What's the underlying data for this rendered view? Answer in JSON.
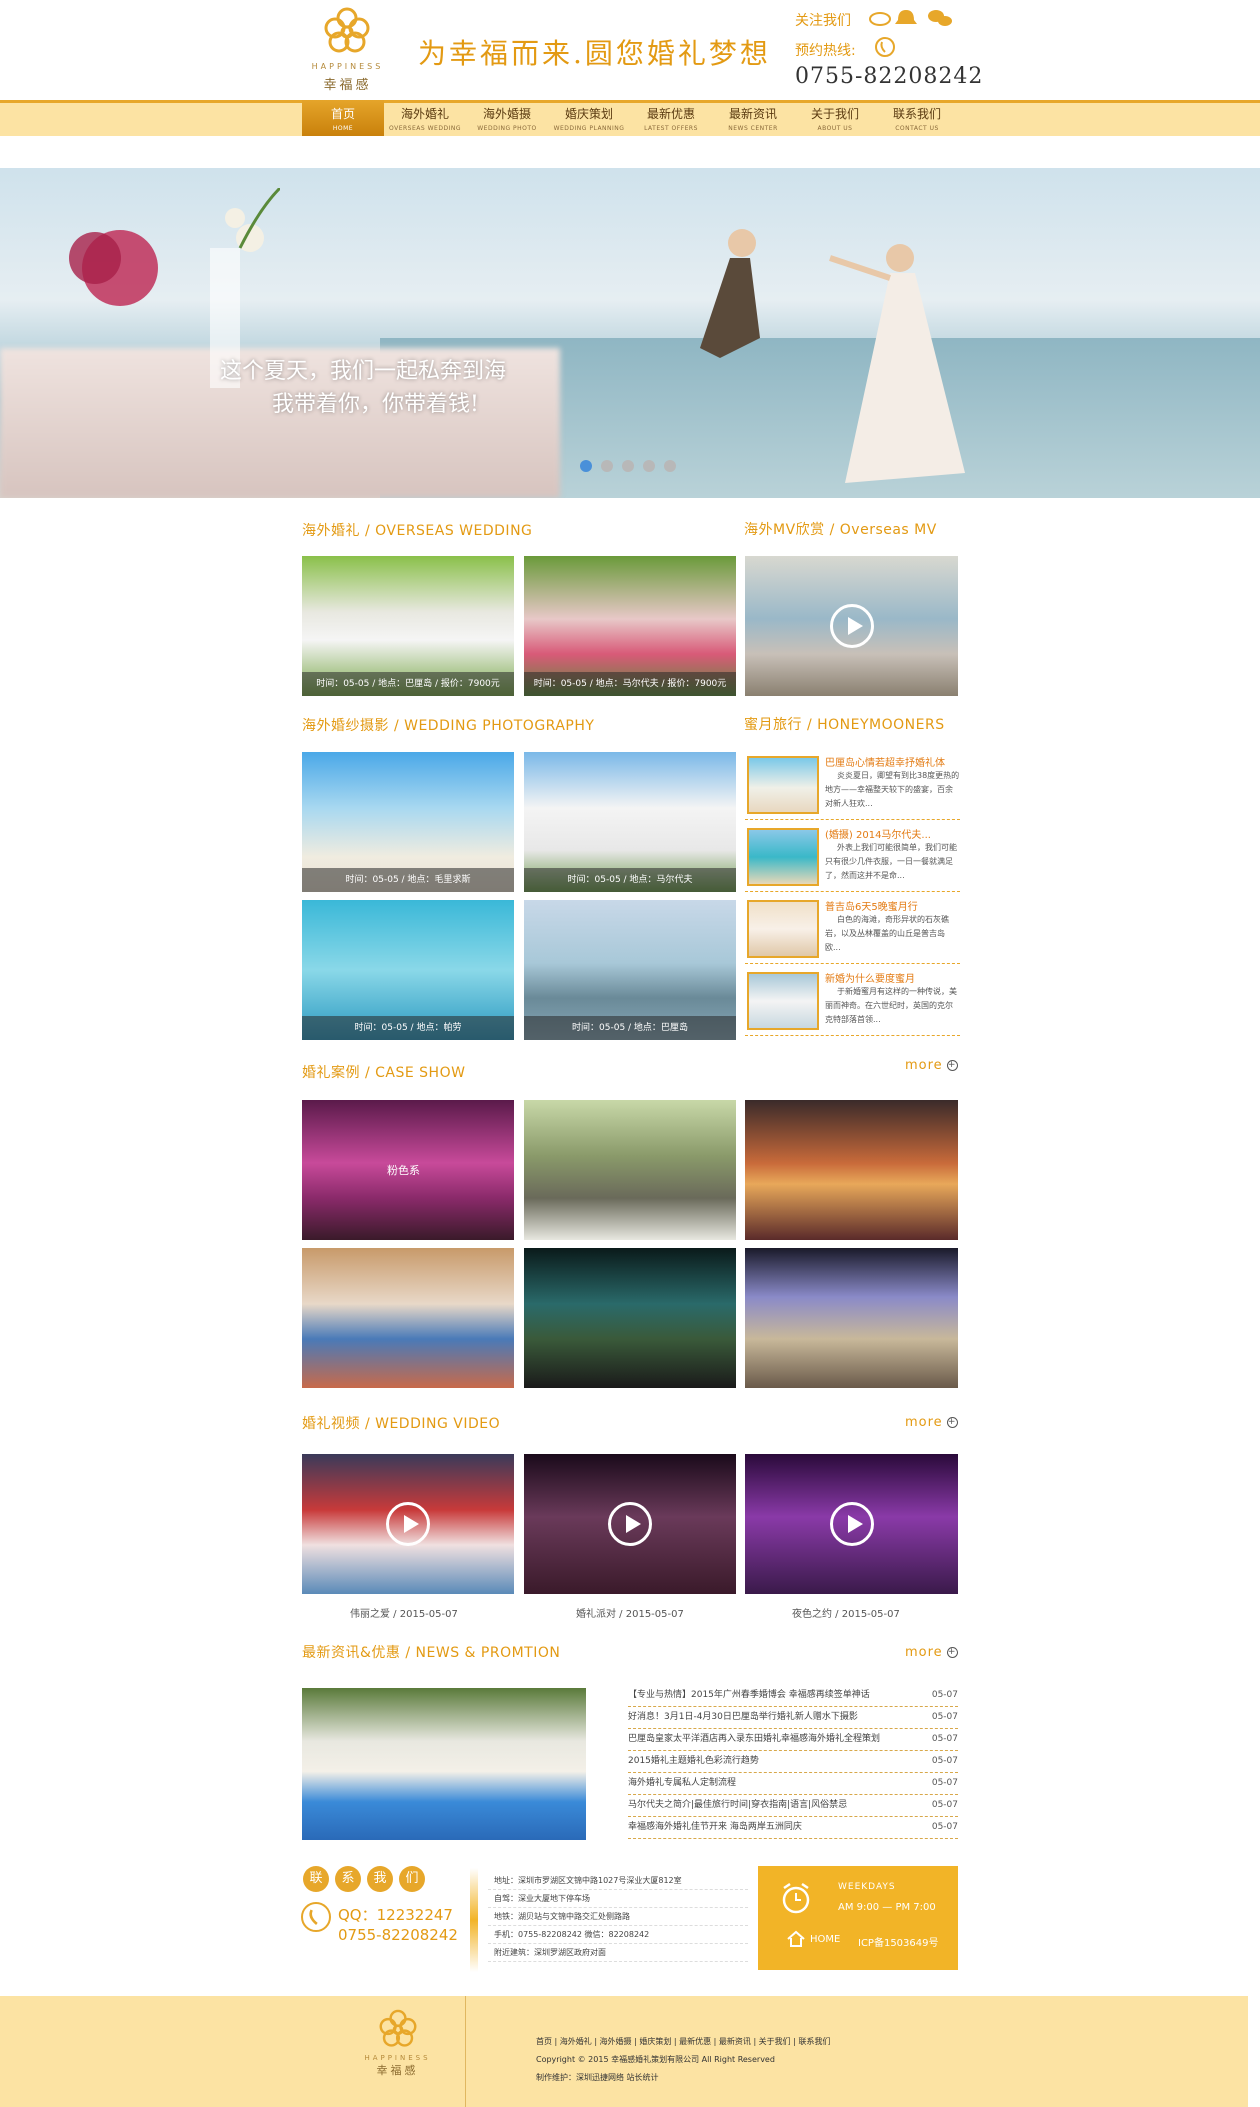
{
  "header": {
    "logo_en": "HAPPINESS",
    "logo_cn": "幸福感",
    "slogan": "为幸福而来.圆您婚礼梦想",
    "follow_label": "关注我们",
    "hotline_label": "预约热线:",
    "tel": "0755-82208242"
  },
  "nav": [
    {
      "cn": "首页",
      "en": "HOME"
    },
    {
      "cn": "海外婚礼",
      "en": "OVERSEAS WEDDING"
    },
    {
      "cn": "海外婚摄",
      "en": "WEDDING PHOTO"
    },
    {
      "cn": "婚庆策划",
      "en": "WEDDING PLANNING"
    },
    {
      "cn": "最新优惠",
      "en": "LATEST OFFERS"
    },
    {
      "cn": "最新资讯",
      "en": "NEWS CENTER"
    },
    {
      "cn": "关于我们",
      "en": "ABOUT US"
    },
    {
      "cn": "联系我们",
      "en": "CONTACT US"
    }
  ],
  "banner": {
    "line1": "这个夏天，我们一起私奔到海",
    "line2": "我带着你，你带着钱!",
    "active_slide": 1,
    "slide_count": 5
  },
  "sections": {
    "overseas_wedding": "海外婚礼 / OVERSEAS WEDDING",
    "overseas_mv": "海外MV欣赏 / Overseas MV",
    "wedding_photo": "海外婚纱摄影 / WEDDING PHOTOGRAPHY",
    "honeymoon": "蜜月旅行 / HONEYMOONERS",
    "case_show": "婚礼案例 / CASE SHOW",
    "wedding_video": "婚礼视频 / WEDDING VIDEO",
    "news": "最新资讯&优惠 / NEWS & PROMTION",
    "more": "more"
  },
  "overseas_items": [
    "时间：05-05 / 地点：巴厘岛 / 报价：7900元",
    "时间：05-05 / 地点：马尔代夫 / 报价：7900元"
  ],
  "photo_items": [
    "时间：05-05 / 地点：毛里求斯",
    "时间：05-05 / 地点：马尔代夫",
    "时间：05-05 / 地点：帕劳",
    "时间：05-05 / 地点：巴厘岛"
  ],
  "honeymoon_items": [
    {
      "title": "巴厘岛心情若超幸抒婚礼体",
      "text": "炎炎夏日，卿望有到比38度更热的地方——幸福整天较下的盛宴，百余对新人狂欢..."
    },
    {
      "title": "(婚摄) 2014马尔代夫...",
      "text": "外表上我们可能很简单，我们可能只有很少几件衣服，一日一餐就满足了，然而这并不是命..."
    },
    {
      "title": "普吉岛6天5晚蜜月行",
      "text": "白色的海滩，奇形异状的石灰礁岩，以及丛林覆盖的山丘是普吉岛欧..."
    },
    {
      "title": "新婚为什么要度蜜月",
      "text": "于新婚蜜月有这样的一种传说，美丽而神奇。在六世纪时，英国的克尔克特部落首领..."
    }
  ],
  "case_label": "粉色系",
  "video_items": [
    "伟丽之爱 / 2015-05-07",
    "婚礼派对 / 2015-05-07",
    "夜色之约 / 2015-05-07"
  ],
  "news_items": [
    {
      "title": "【专业与热情】2015年广州春季婚博会 幸福感再续签单神话",
      "date": "05-07"
    },
    {
      "title": "好消息！3月1日-4月30日巴厘岛举行婚礼新人赠水下摄影",
      "date": "05-07"
    },
    {
      "title": "巴厘岛皇家太平洋酒店再入录东田婚礼幸福感海外婚礼全程策划",
      "date": "05-07"
    },
    {
      "title": "2015婚礼主题婚礼色彩流行趋势",
      "date": "05-07"
    },
    {
      "title": "海外婚礼专属私人定制流程",
      "date": "05-07"
    },
    {
      "title": "马尔代夫之简介|最佳旅行时间|穿衣指南|语言|风俗禁忌",
      "date": "05-07"
    },
    {
      "title": "幸福感海外婚礼佳节开来 海岛两岸五洲同庆",
      "date": "05-07"
    }
  ],
  "contact": {
    "circles": [
      "联",
      "系",
      "我",
      "们"
    ],
    "qq": "QQ：12232247",
    "tel": "0755-82208242",
    "address_lines": [
      "地址：深圳市罗湖区文锦中路1027号深业大厦812室",
      "自驾：深业大厦地下停车场",
      "地铁：湖贝站与文锦中路交汇处侧路路",
      "手机：0755-82208242  微信：82208242",
      "附近建筑：深圳罗湖区政府对面"
    ],
    "hours_label": "WEEKDAYS",
    "hours": "AM 9:00 — PM 7:00",
    "home_label": "HOME",
    "icp": "ICP备1503649号"
  },
  "footer": {
    "logo_en": "HAPPINESS",
    "logo_cn": "幸福感",
    "links": "首页 | 海外婚礼 | 海外婚摄 | 婚庆策划 | 最新优惠 | 最新资讯 | 关于我们 | 联系我们",
    "copyright": "Copyright © 2015 幸福感婚礼策划有限公司 All Right Reserved",
    "made": "制作维护：深圳迅捷网络  站长统计"
  },
  "colors": {
    "accent": "#e39a13",
    "nav_bg": "#fce3a3",
    "footer_bg": "#fce3a3",
    "hours_bg": "#f2b427"
  }
}
